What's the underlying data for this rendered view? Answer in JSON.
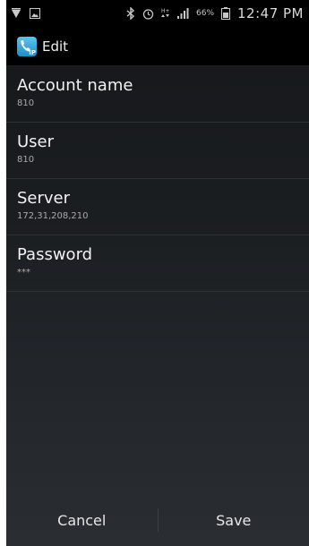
{
  "statusbar": {
    "battery_pct": "66%",
    "time": "12:47 PM",
    "left_icons": [
      "notification-play-icon",
      "image-icon"
    ],
    "right_icons": [
      "bluetooth-icon",
      "alarm-icon",
      "hplus-network-icon",
      "signal-icon",
      "battery-icon"
    ]
  },
  "actionbar": {
    "title": "Edit",
    "icon_badge": "IP",
    "accent": "#1a8fc9"
  },
  "prefs": [
    {
      "title": "Account name",
      "summary": "810"
    },
    {
      "title": "User",
      "summary": "810"
    },
    {
      "title": "Server",
      "summary": "172,31,208,210"
    },
    {
      "title": "Password",
      "summary": "***"
    }
  ],
  "buttons": {
    "cancel": "Cancel",
    "save": "Save"
  }
}
